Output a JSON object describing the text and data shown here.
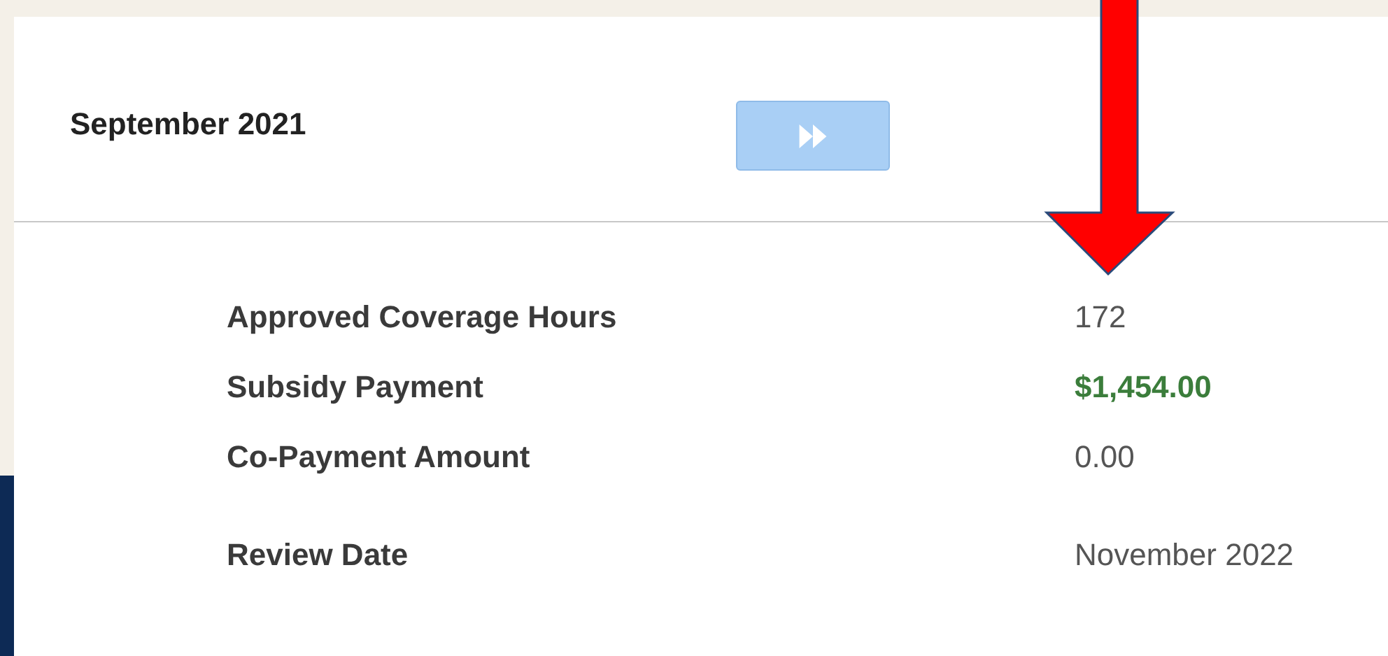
{
  "period": {
    "title": "September 2021"
  },
  "next_button": {
    "disabled": true
  },
  "details": [
    {
      "label": "Approved Coverage Hours",
      "value": "172",
      "kind": "plain"
    },
    {
      "label": "Subsidy Payment",
      "value": "$1,454.00",
      "kind": "amount"
    },
    {
      "label": "Co-Payment Amount",
      "value": "0.00",
      "kind": "plain"
    },
    {
      "label": "Review Date",
      "value": "November 2022",
      "kind": "date"
    }
  ]
}
